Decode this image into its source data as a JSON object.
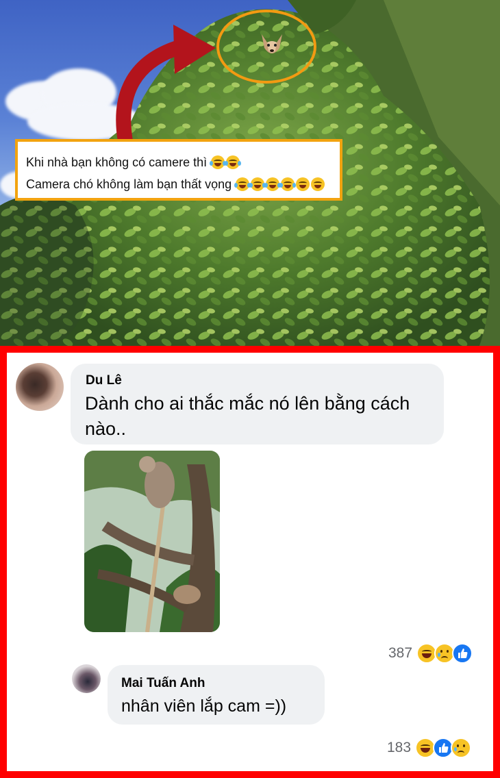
{
  "post": {
    "caption_line1": "Khi nhà bạn không có camere thì",
    "caption_line2": "Camera chó không làm bạn thất vọng"
  },
  "comments": [
    {
      "author": "Du Lê",
      "text": "Dành cho ai thắc mắc nó lên bằng cách nào..",
      "reaction_count": "387",
      "reactions": [
        "haha-icon",
        "sad-icon",
        "like-icon"
      ]
    },
    {
      "author": "Mai Tuấn Anh",
      "text": "nhân viên lắp cam =))",
      "reaction_count": "183",
      "reactions": [
        "haha-icon",
        "like-icon",
        "sad-icon"
      ]
    }
  ],
  "colors": {
    "panel_border": "#ff0000",
    "caption_border": "#f2a30f",
    "circle": "#f39a12",
    "arrow": "#b3141c",
    "bubble": "#eff1f3"
  }
}
